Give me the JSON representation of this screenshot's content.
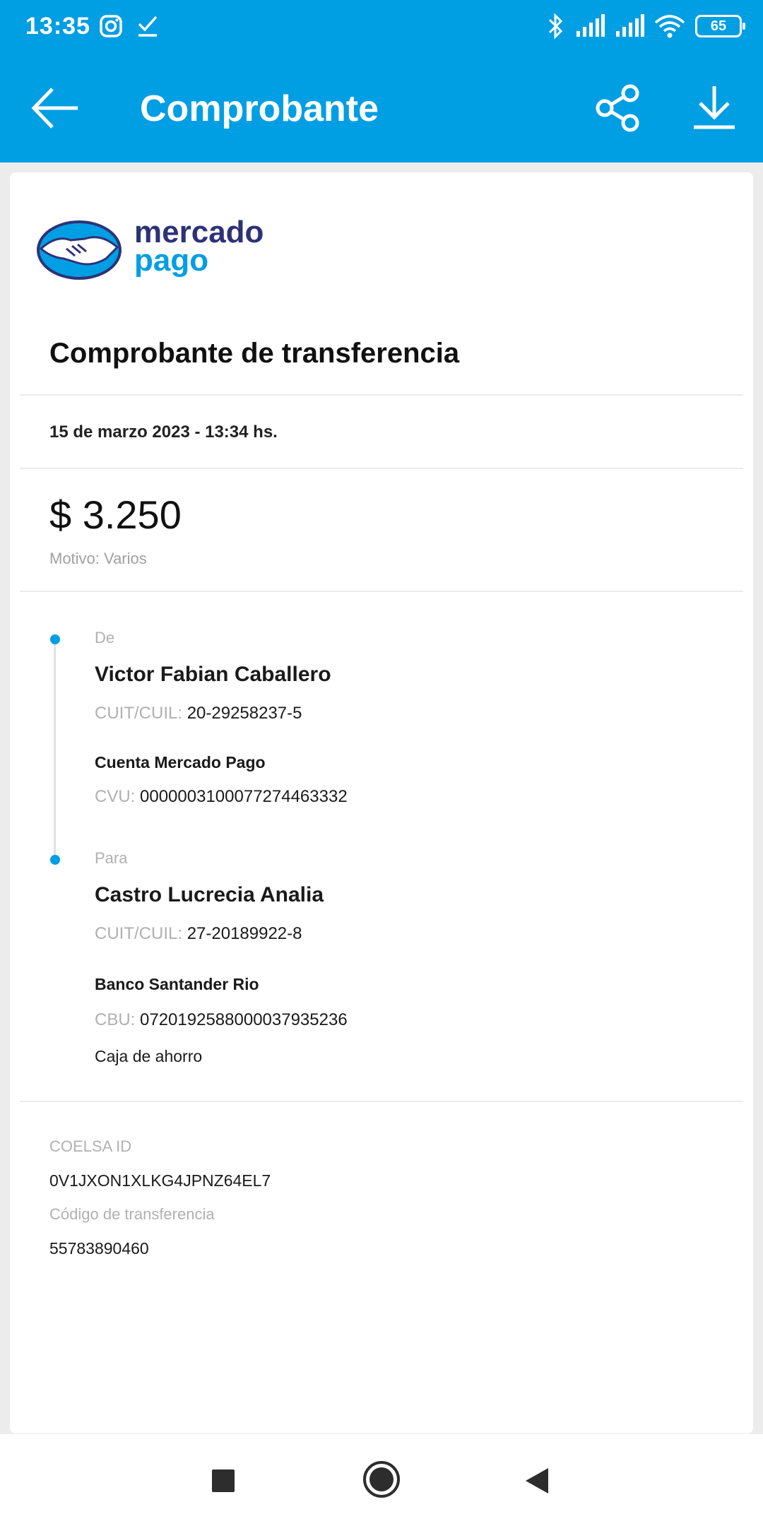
{
  "status_bar": {
    "time": "13:35",
    "battery": "65",
    "icons": [
      "instagram-icon",
      "check-icon",
      "bluetooth-icon",
      "signal-icon",
      "signal-icon",
      "wifi-icon",
      "battery-icon"
    ]
  },
  "app_bar": {
    "title": "Comprobante",
    "back_icon": "arrow-left-icon",
    "share_icon": "share-icon",
    "download_icon": "download-icon",
    "color": "#009ee3"
  },
  "logo": {
    "word1": "mercado",
    "word2": "pago",
    "icon": "handshake-icon"
  },
  "receipt": {
    "heading": "Comprobante de transferencia",
    "date": "15 de marzo 2023 - 13:34 hs.",
    "amount": "$ 3.250",
    "motivo": "Motivo: Varios"
  },
  "from": {
    "label": "De",
    "name": "Victor Fabian Caballero",
    "id_key": "CUIT/CUIL:",
    "id_value": "20-29258237-5",
    "account": "Cuenta Mercado Pago",
    "cvu_key": "CVU:",
    "cvu_value": "0000003100077274463332"
  },
  "to": {
    "label": "Para",
    "name": "Castro Lucrecia Analia",
    "id_key": "CUIT/CUIL:",
    "id_value": "27-20189922-8",
    "bank": "Banco Santander Rio",
    "cbu_key": "CBU:",
    "cbu_value": "0720192588000037935236",
    "account_type": "Caja de ahorro"
  },
  "ids": {
    "coelsa_label": "COELSA ID",
    "coelsa_value": "0V1JXON1XLKG4JPNZ64EL7",
    "code_label": "Código de transferencia",
    "code_value": "55783890460"
  },
  "nav_bar": {
    "icons": [
      "recent-apps-icon",
      "home-icon",
      "back-icon"
    ]
  }
}
